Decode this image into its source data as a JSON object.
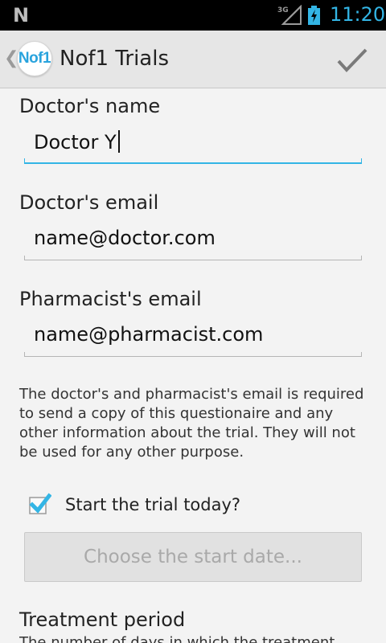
{
  "status_bar": {
    "notification_icon": "N",
    "network_type": "3G",
    "time": "11:20"
  },
  "action_bar": {
    "logo_text": "Nof1",
    "title": "Nof1 Trials",
    "accent_color": "#33b5e5"
  },
  "form": {
    "doctor_name": {
      "label": "Doctor's name",
      "value": "Doctor Y"
    },
    "doctor_email": {
      "label": "Doctor's email",
      "value": "name@doctor.com"
    },
    "pharmacist_email": {
      "label": "Pharmacist's email",
      "value": "name@pharmacist.com"
    },
    "info_text": "The doctor's and pharmacist's email is required to send a copy of this questionaire and any other information about the trial. They will not be used for any other purpose.",
    "start_today": {
      "label": "Start the trial today?",
      "checked": true
    },
    "choose_date_button": "Choose the start date...",
    "treatment_period_title": "Treatment period",
    "treatment_period_text": "The number of days in which the treatment"
  }
}
